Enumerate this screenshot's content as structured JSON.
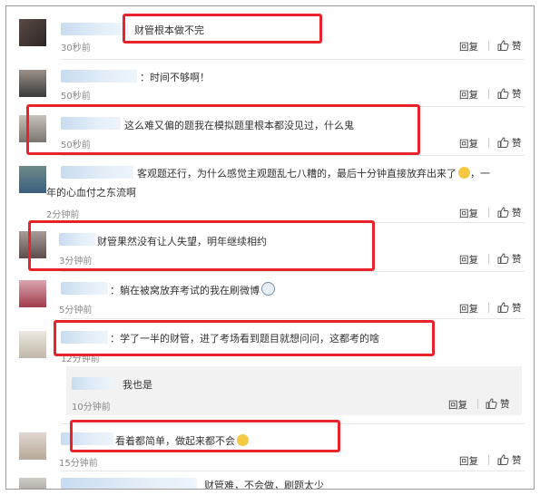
{
  "actions": {
    "reply": "回复",
    "like": "赞"
  },
  "comments": [
    {
      "text": "财管根本做不完",
      "time": "30秒前"
    },
    {
      "text": "：时间不够啊！",
      "time": "50秒前"
    },
    {
      "text": "这么难又偏的题我在模拟题里根本都没见过，什么鬼",
      "time": "50秒前"
    },
    {
      "text": "客观题还行，为什么感觉主观题乱七八糟的，最后十分钟直接放弃出来了",
      "text_line2": "年的心血付之东流啊",
      "text_tail": "，一",
      "time": "2分钟前"
    },
    {
      "text": "财管果然没有让人失望，明年继续相约",
      "time": "3分钟前"
    },
    {
      "text": "：躺在被窝放弃考试的我在刷微博",
      "time": "5分钟前"
    },
    {
      "text": "：学了一半的财管，进了考场看到题目就想问问，这都考的啥",
      "time": "12分钟前"
    },
    {
      "text": "我也是",
      "time": "10分钟前"
    },
    {
      "text": "看着都简单，做起来都不会",
      "time": "15分钟前"
    },
    {
      "text": "财管难，不会做，刷题太少"
    }
  ]
}
